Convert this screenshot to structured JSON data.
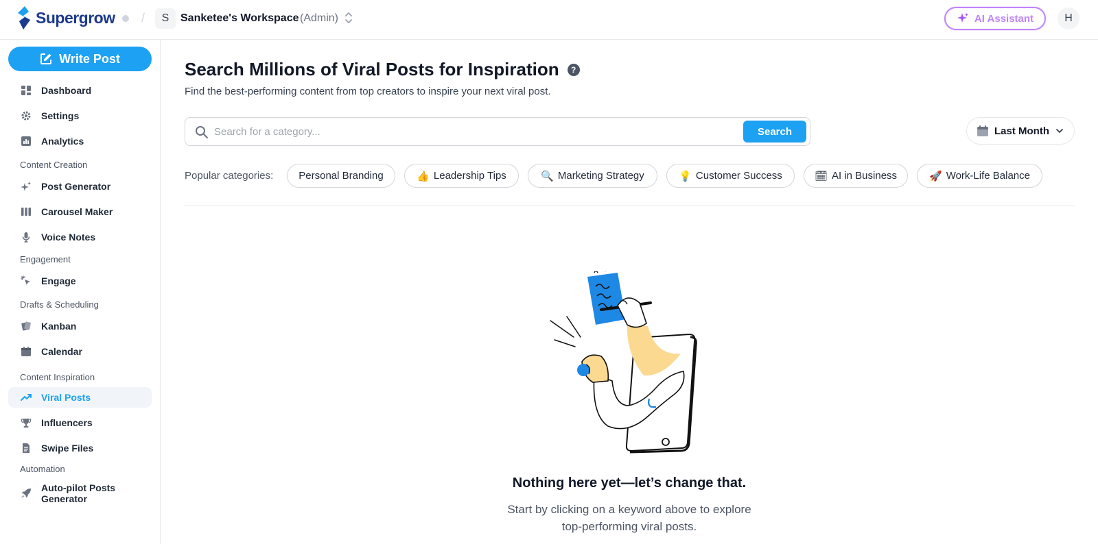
{
  "topbar": {
    "brand": "Supergrow",
    "workspace_initial": "S",
    "workspace_name": "Sanketee's Workspace",
    "workspace_role": "(Admin)",
    "ai_assistant_label": "AI Assistant",
    "user_initial": "H"
  },
  "sidebar": {
    "write_post_label": "Write Post",
    "items": {
      "dashboard": "Dashboard",
      "settings": "Settings",
      "analytics": "Analytics",
      "post_generator": "Post Generator",
      "carousel_maker": "Carousel Maker",
      "voice_notes": "Voice Notes",
      "engage": "Engage",
      "kanban": "Kanban",
      "calendar": "Calendar",
      "viral_posts": "Viral Posts",
      "influencers": "Influencers",
      "swipe_files": "Swipe Files",
      "autopilot_line1": "Auto-pilot Posts",
      "autopilot_line2": "Generator"
    },
    "sections": {
      "content_creation": "Content Creation",
      "engagement": "Engagement",
      "drafts_scheduling": "Drafts & Scheduling",
      "content_inspiration": "Content Inspiration",
      "automation": "Automation"
    },
    "active_item": "Viral Posts"
  },
  "main": {
    "title": "Search Millions of Viral Posts for Inspiration",
    "subtitle": "Find the best-performing content from top creators to inspire your next viral post.",
    "search": {
      "placeholder": "Search for a category...",
      "value": "",
      "button_label": "Search"
    },
    "date_filter": "Last Month",
    "popular_label": "Popular categories:",
    "categories": [
      {
        "emoji": "",
        "label": "Personal Branding"
      },
      {
        "emoji": "👍",
        "label": "Leadership Tips"
      },
      {
        "emoji": "🔍",
        "label": "Marketing Strategy"
      },
      {
        "emoji": "💡",
        "label": "Customer Success"
      },
      {
        "emoji": "🗓",
        "label": "AI in Business"
      },
      {
        "emoji": "🚀",
        "label": "Work-Life Balance"
      }
    ],
    "empty_state": {
      "title": "Nothing here yet—let’s change that.",
      "subtitle_line1": "Start by clicking on a keyword above to explore",
      "subtitle_line2": "top-performing viral posts."
    }
  },
  "colors": {
    "primary": "#1da1f2",
    "brand_dark": "#1b3a8c",
    "ai_purple": "#c084fc",
    "illustration_blue": "#1e88e5",
    "illustration_yellow": "#fcd990"
  }
}
